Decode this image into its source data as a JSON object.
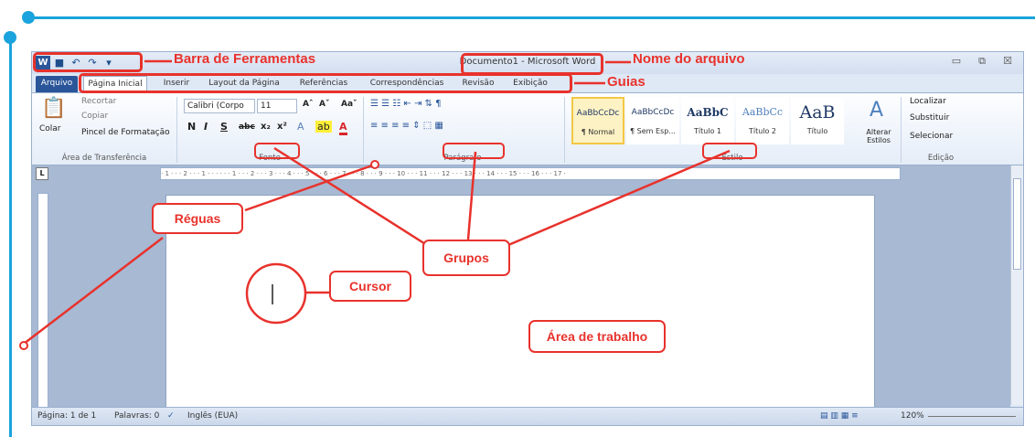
{
  "window": {
    "title": "Documento1 - Microsoft Word",
    "min_glyph": "▭",
    "restore_glyph": "⧉",
    "close_glyph": "☒"
  },
  "quick_access": [
    "W",
    "■",
    "↶",
    "↷",
    "▾"
  ],
  "tabs": [
    "Arquivo",
    "Página Inicial",
    "Inserir",
    "Layout da Página",
    "Referências",
    "Correspondências",
    "Revisão",
    "Exibição"
  ],
  "help_glyphs": "⌂ ❓",
  "ribbon": {
    "clipboard": {
      "paste": "Colar",
      "cut": "Recortar",
      "copy": "Copiar",
      "painter": "Pincel de Formatação",
      "label": "Área de Transferência"
    },
    "font": {
      "name": "Calibri (Corpo",
      "size": "11",
      "grow": "Aˆ",
      "shrink": "Aˇ",
      "case": "Aaˇ",
      "bold": "N",
      "italic": "I",
      "underline": "S",
      "strike": "abc",
      "sub": "x₂",
      "sup": "x²",
      "label": "Fonte"
    },
    "paragraph": {
      "label": "Parágrafo",
      "row1": "☰ ☰ ☷  ⇤ ⇥  ⇅  ¶",
      "row2": "≡ ≡ ≡ ≡  ⇕  ⬚ ▦"
    },
    "styles": {
      "items": [
        {
          "preview": "AaBbCcDc",
          "name": "¶ Normal"
        },
        {
          "preview": "AaBbCcDc",
          "name": "¶ Sem Esp..."
        },
        {
          "preview": "AaBbC",
          "name": "Título 1"
        },
        {
          "preview": "AaBbCc",
          "name": "Título 2"
        },
        {
          "preview": "AaB",
          "name": "Título"
        }
      ],
      "change": "Alterar Estilos",
      "label": "Estilo"
    },
    "editing": {
      "find": "Localizar",
      "replace": "Substituir",
      "select": "Selecionar",
      "label": "Edição"
    }
  },
  "ruler": "· 1 · · · 2 · · · 1 · · · · · · 1 · · · 2 · · · 3 · · · 4 · · · 5 · · · 6 · · · 7 · · · 8 · · · 9 · · · 10 · · · 11 · · · 12 · · · 13 · · · 14 · · · 15 · · · 16 · · · 17 ·",
  "status": {
    "page": "Página: 1 de 1",
    "words": "Palavras: 0",
    "language": "Inglês (EUA)",
    "zoom": "120%"
  },
  "annotations": {
    "toolbar": "Barra de Ferramentas",
    "filename": "Nome do arquivo",
    "tabs": "Guias",
    "rulers": "Réguas",
    "groups": "Grupos",
    "cursor": "Cursor",
    "workarea": "Área de trabalho"
  },
  "colors": {
    "accent_blue": "#1aa3dc",
    "annotation_red": "#e8322c",
    "word_blue": "#2a5699"
  }
}
